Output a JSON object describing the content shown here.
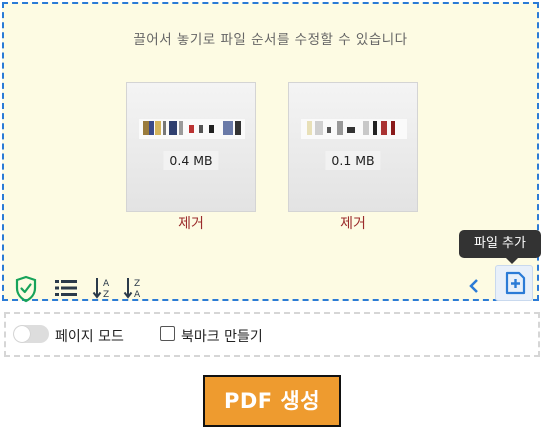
{
  "dropzone": {
    "hint": "끌어서 놓기로 파일 순서를 수정할 수 있습니다",
    "files": [
      {
        "size": "0.4 MB",
        "remove_label": "제거"
      },
      {
        "size": "0.1 MB",
        "remove_label": "제거"
      }
    ]
  },
  "toolbar": {
    "tools": [
      "shield-check-icon",
      "list-icon",
      "sort-az-icon",
      "sort-za-icon"
    ],
    "prev_icon": "chevron-left-icon",
    "add_file_icon": "add-file-icon",
    "add_file_tooltip": "파일 추가"
  },
  "options": {
    "page_mode_label": "페이지 모드",
    "page_mode_enabled": false,
    "bookmark_label": "북마크 만들기",
    "bookmark_checked": false
  },
  "generate_label": "PDF 생성",
  "colors": {
    "accent": "#2b7bd6",
    "generate_button": "#ee9b2f",
    "remove_text": "#9b2b2b",
    "shield": "#17a35a",
    "dropzone_bg": "#fdfbe3"
  }
}
